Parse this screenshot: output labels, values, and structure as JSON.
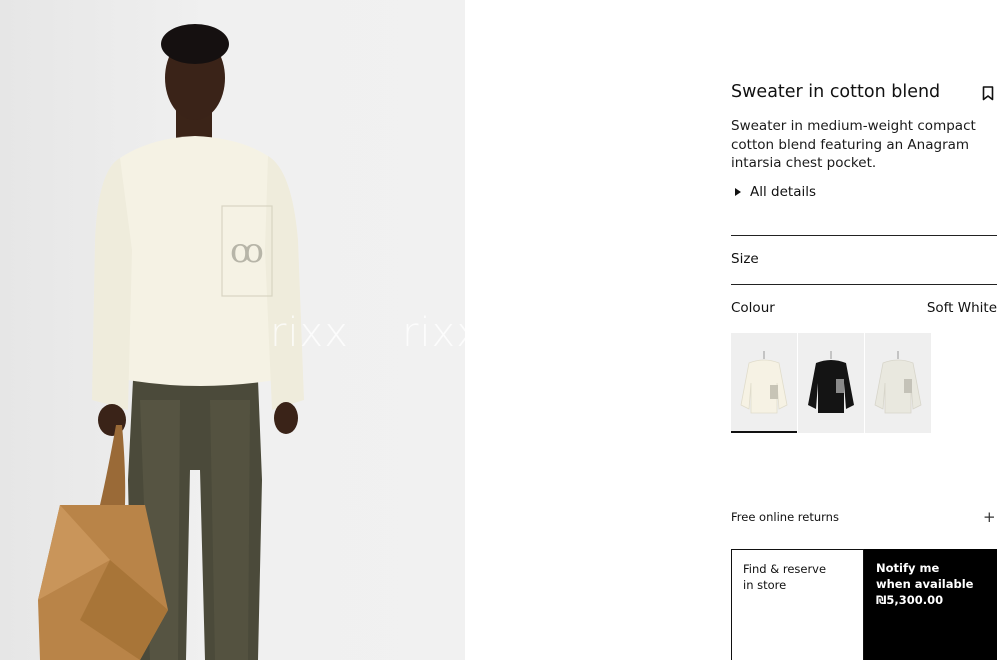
{
  "product": {
    "title": "Sweater in cotton blend",
    "description": "Sweater in medium-weight compact cotton blend featuring an Anagram intarsia chest pocket.",
    "details_toggle": "All details",
    "size_label": "Size",
    "colour_label": "Colour",
    "colour_value": "Soft White",
    "swatches": [
      {
        "colour": "Soft White",
        "selected": true
      },
      {
        "colour": "Black",
        "selected": false
      },
      {
        "colour": "Light Grey",
        "selected": false
      }
    ],
    "returns_label": "Free online returns",
    "find_store_label": "Find & reserve in store",
    "notify_label": "Notify me when available",
    "price": "₪5,300.00"
  },
  "media": {
    "watermark_text": "rixx",
    "bag_color": "#b98448",
    "sweater_color": "#f5f2e4",
    "jeans_color": "#4b4a3a"
  },
  "icons": {
    "bookmark": "bookmark-icon",
    "expand": "triangle-right-icon",
    "plus": "plus-icon"
  }
}
